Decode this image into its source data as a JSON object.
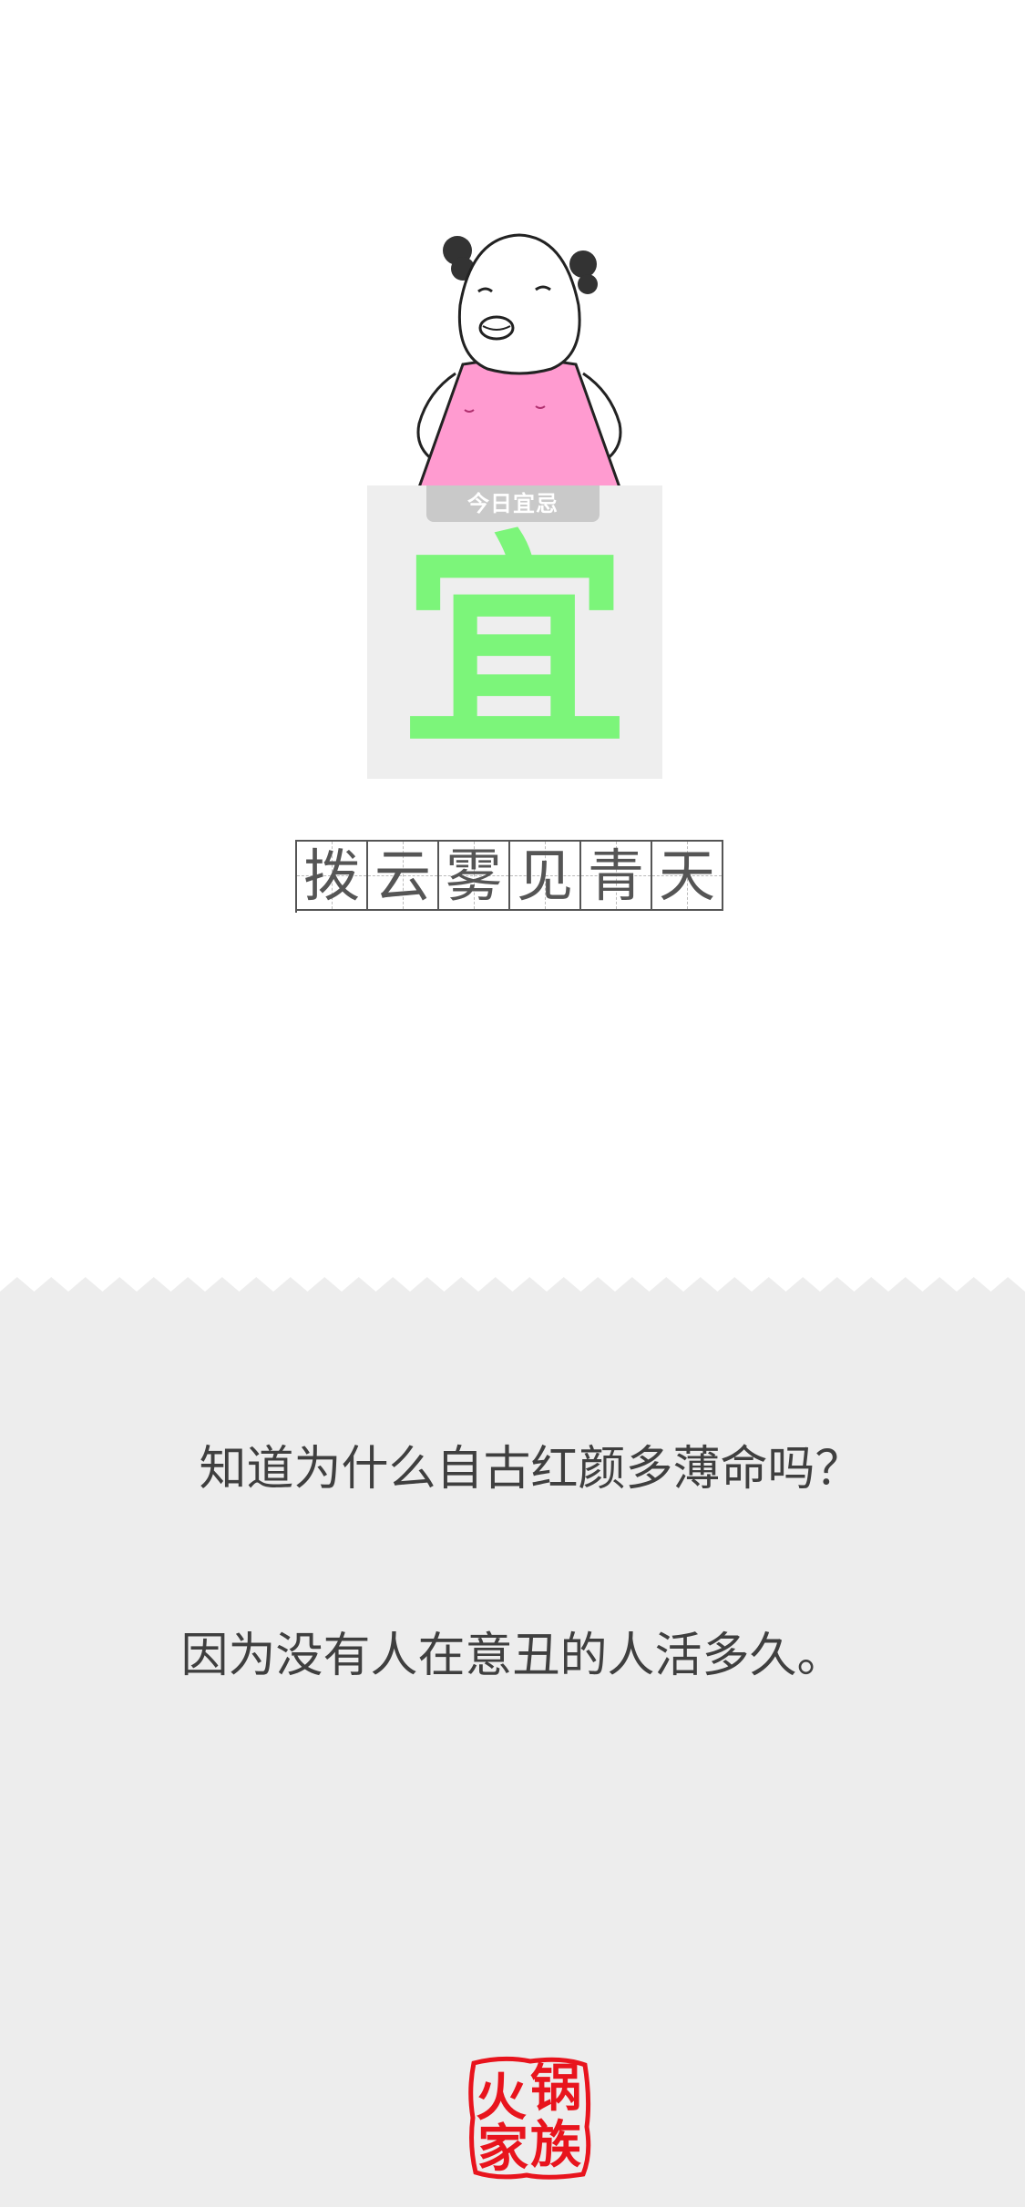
{
  "card": {
    "tag": "今日宜忌",
    "glyph": "宜",
    "glyph_color": "#7cf57a"
  },
  "phrase": [
    "拨",
    "云",
    "雾",
    "见",
    "青",
    "天"
  ],
  "text": {
    "line1": "知道为什么自古红颜多薄命吗？",
    "line2": "因为没有人在意丑的人活多久。"
  },
  "logo": {
    "chars": [
      "火",
      "锅",
      "家",
      "族"
    ],
    "color": "#e8141d"
  }
}
